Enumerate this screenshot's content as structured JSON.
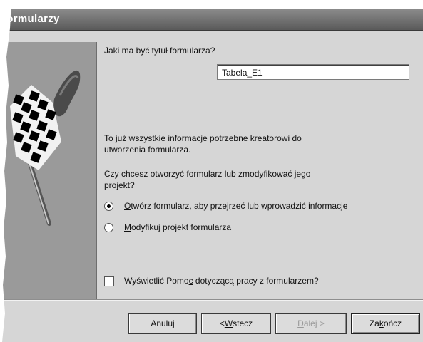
{
  "window": {
    "title": "formularzy"
  },
  "title_question": "Jaki ma być tytuł formularza?",
  "form_title_value": "Tabela_E1",
  "info_text": "To już wszystkie informacje potrzebne kreatorowi do\nutworzenia formularza.",
  "open_question": "Czy chcesz otworzyć formularz lub zmodyfikować jego\nprojekt?",
  "options": {
    "open_accesskey": "O",
    "open_rest": "twórz formularz, aby przejrzeć lub wprowadzić informacje",
    "modify_accesskey": "M",
    "modify_rest": "odyfikuj projekt formularza",
    "selected": "open"
  },
  "help": {
    "label_prefix": "Wyświetlić Pomo",
    "label_accesskey": "c",
    "label_suffix": " dotyczącą pracy z formularzem?",
    "checked": false
  },
  "buttons": {
    "cancel": "Anuluj",
    "back_prefix": "< ",
    "back_accesskey": "W",
    "back_rest": "stecz",
    "next_accesskey": "D",
    "next_rest": "alej >",
    "finish_prefix": "Za",
    "finish_accesskey": "k",
    "finish_rest": "ończ"
  },
  "icons": {
    "wizard_graphic": "checkered-flag-icon",
    "radio": "radio-button",
    "checkbox": "checkbox"
  }
}
